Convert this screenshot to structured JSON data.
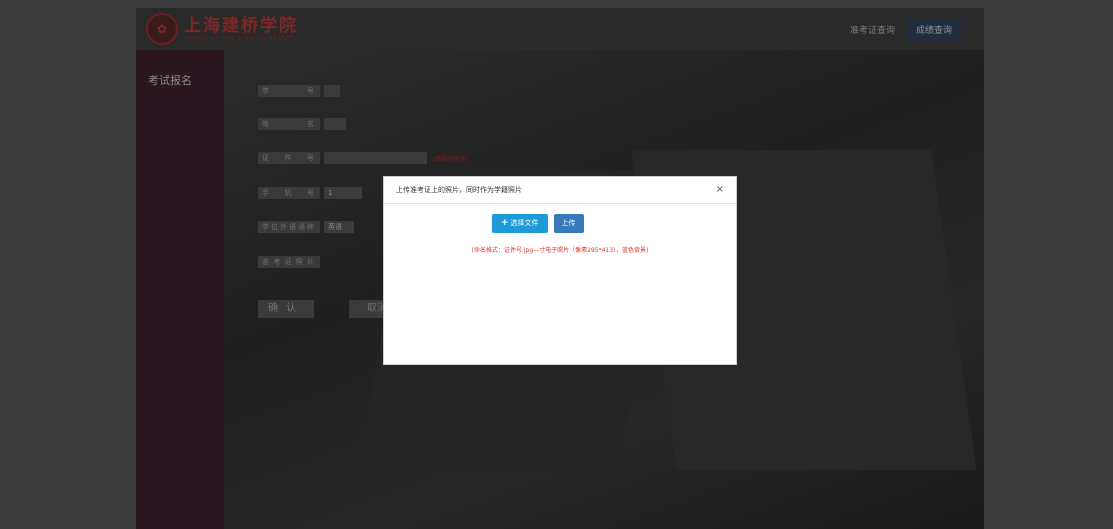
{
  "header": {
    "logo_cn": "上海建桥学院",
    "logo_en": "SHANGHAI JIAN QIAO UNIVERSITY",
    "nav_admission": "准考证查询",
    "nav_score": "成绩查询"
  },
  "sidebar": {
    "title": "考试报名"
  },
  "form": {
    "student_id_label": "学号",
    "name_label": "姓名",
    "id_number_label": "证件号",
    "id_hint": "(请核对信息)",
    "phone_label": "手机号",
    "phone_value": "1",
    "language_label": "学位外语语种",
    "language_value": "英语",
    "photo_label": "准考证照片",
    "confirm_label": "确认",
    "cancel_label": "取消"
  },
  "modal": {
    "title": "上传准考证上的照片，同时作为学籍照片",
    "close_label": "×",
    "choose_file_label": "选择文件",
    "upload_label": "上传",
    "hint": "(命名格式：证件号.jpg—寸电子照片（像素295*413），蓝色背景)"
  },
  "colors": {
    "choose_btn": "#1e9bd7",
    "upload_btn": "#3779bb",
    "hint_text": "#d9382f",
    "sidebar": "#2a161f"
  },
  "icons": {
    "logo": "university-seal-icon",
    "close": "close-icon",
    "choose": "plus-icon"
  }
}
